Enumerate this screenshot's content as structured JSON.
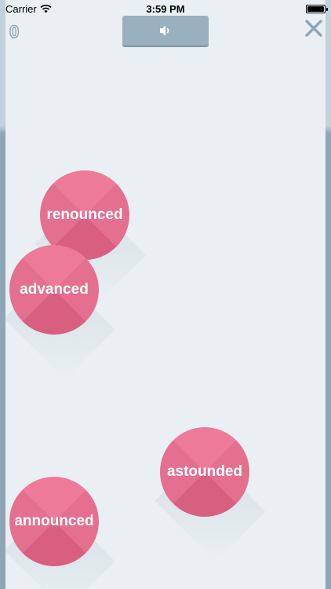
{
  "status_bar": {
    "carrier": "Carrier",
    "time": "3:59 PM"
  },
  "top": {
    "score": "0",
    "speaker_icon": "speaker-icon",
    "close_icon": "close-icon"
  },
  "words": [
    {
      "label": "renounced"
    },
    {
      "label": "advanced"
    },
    {
      "label": "astounded"
    },
    {
      "label": "announced"
    }
  ],
  "colors": {
    "background": "#e9eff2",
    "bubble": "#e56f8e",
    "button": "#9bb0bf",
    "accent": "#8ea6b5"
  }
}
